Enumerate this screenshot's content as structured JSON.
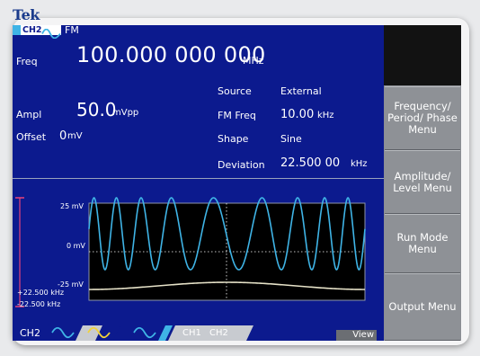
{
  "brand": "Tek",
  "header": {
    "channel": "CH2",
    "modulation": "FM"
  },
  "freq": {
    "label": "Freq",
    "value": "100.000 000 000",
    "unit": "MHz"
  },
  "ampl": {
    "label": "Ampl",
    "value": "50.0",
    "unit": "mVpp"
  },
  "offset": {
    "label": "Offset",
    "value": "0",
    "unit": "mV"
  },
  "fm": {
    "source_label": "Source",
    "source_value": "External",
    "freq_label": "FM Freq",
    "freq_value": "10.00",
    "freq_unit": "kHz",
    "shape_label": "Shape",
    "shape_value": "Sine",
    "deviation_label": "Deviation",
    "deviation_value": "22.500 00",
    "deviation_unit": "kHz"
  },
  "waveform": {
    "top_label": "25 mV",
    "mid_label": "0 mV",
    "bottom_label": "-25 mV",
    "dev_plus": "+22.500 kHz",
    "dev_minus": "-22.500 kHz"
  },
  "softkeys": [
    {
      "label": "Frequency/ Period/ Phase Menu"
    },
    {
      "label": "Amplitude/ Level Menu"
    },
    {
      "label": "Run Mode Menu"
    },
    {
      "label": "Output Menu"
    }
  ],
  "bottom_bar": {
    "channel": "CH2",
    "ch1": "CH1",
    "ch2": "CH2",
    "view": "View"
  },
  "colors": {
    "screen_bg": "#0c1a8e",
    "carrier_trace": "#3fb4e6",
    "modulation_trace": "#e6e2c8",
    "softkey_bg": "#8e9196",
    "accent_pink": "#e8427a",
    "accent_yellow": "#f1d23a"
  }
}
